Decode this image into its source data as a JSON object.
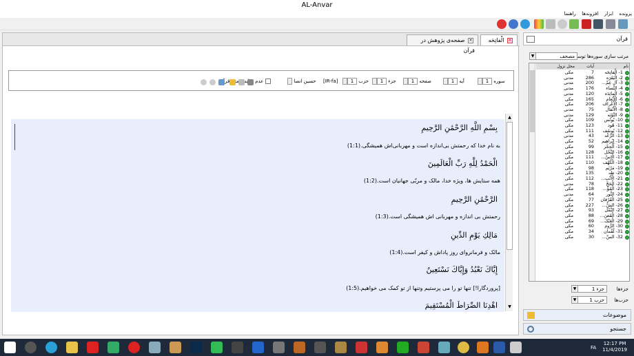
{
  "window": {
    "title": "AL-Anvar"
  },
  "menu": [
    "پرونده",
    "ابزار",
    "افزونه‌ها",
    "راهنما"
  ],
  "tabs": [
    {
      "label": "الْفاتِحَه"
    },
    {
      "label": "صفحه‌ی پژوهش در قرآن"
    }
  ],
  "controls": {
    "surah_label": "سوره",
    "surah_value": "1",
    "ayah_label": "آیه",
    "ayah_value": "1",
    "page_label": "صفحه",
    "page_value": "1",
    "juz_label": "جزء",
    "juz_value": "1",
    "hizb_label": "حزب",
    "hizb_value": "1",
    "lang_value": "[IR-fa]",
    "reciter_value": "حسین انصا",
    "hide_text_label": "عدم نمایش متن قرآن"
  },
  "reader": {
    "lines": [
      {
        "arabic": "بِسْمِ اللَّهِ الرَّحْمَٰنِ الرَّحِيمِ",
        "translation": "به نام خدا که رحمتش بی‌اندازه است و مهربانی‌اش همیشگی.(1:1)"
      },
      {
        "arabic": "الْحَمْدُ لِلَّهِ رَبِّ الْعَالَمِينَ",
        "translation": "همه ستایش ها، ویژه خدا، مالک و مربّی جهانیان است.(1:2)"
      },
      {
        "arabic": "الرَّحْمَٰنِ الرَّحِيمِ",
        "translation": "رحمتش بی اندازه و مهربانی اش همیشگی است.(1:3)"
      },
      {
        "arabic": "مَالِكِ يَوْمِ الدِّينِ",
        "translation": "مالک و فرمانروای روز پاداش و کیفر است.(1:4)"
      },
      {
        "arabic": "إِيَّاكَ نَعْبُدُ وَإِيَّاكَ نَسْتَعِينُ",
        "translation": "[پروردگارا!] تنها تو را می پرستیم وتنها از تو کمک می خواهیم.(1:5)"
      },
      {
        "arabic": "اهْدِنَا الصِّرَاطَ الْمُسْتَقِيمَ",
        "translation": ""
      }
    ]
  },
  "sidebar": {
    "header": "قرآن",
    "sort_label": "مرتب سازی سوره‌ها توسط",
    "sort_value": "مصحف",
    "columns": {
      "name": "نام",
      "ayat": "آیات",
      "order": "محل نزول"
    },
    "surahs": [
      {
        "name": "1- الْفاتِحَه",
        "ayat": "7",
        "place": "مکی"
      },
      {
        "name": "2- الْبَقَرَه",
        "ayat": "286",
        "place": "مدنی"
      },
      {
        "name": "3- آل عِمْ...",
        "ayat": "200",
        "place": "مدنی"
      },
      {
        "name": "4- النِّساء",
        "ayat": "176",
        "place": "مدنی"
      },
      {
        "name": "5- الْمائِدَه",
        "ayat": "120",
        "place": "مدنی"
      },
      {
        "name": "6- الْأَنْعام",
        "ayat": "165",
        "place": "مکی"
      },
      {
        "name": "7- الْأَعْراف",
        "ayat": "206",
        "place": "مکی"
      },
      {
        "name": "8- الْأَنْفال",
        "ayat": "75",
        "place": "مدنی"
      },
      {
        "name": "9- التَّوْبَه",
        "ayat": "129",
        "place": "مدنی"
      },
      {
        "name": "10- یُونُس",
        "ayat": "109",
        "place": "مکی"
      },
      {
        "name": "11- هُود",
        "ayat": "123",
        "place": "مکی"
      },
      {
        "name": "12- یُوسُف",
        "ayat": "111",
        "place": "مکی"
      },
      {
        "name": "13- الرَّعْد",
        "ayat": "43",
        "place": "مدنی"
      },
      {
        "name": "14- إِبْراهِیم",
        "ayat": "52",
        "place": "مکی"
      },
      {
        "name": "15- الْحِجْر",
        "ayat": "99",
        "place": "مکی"
      },
      {
        "name": "16- النَّحْل",
        "ayat": "128",
        "place": "مکی"
      },
      {
        "name": "17- الْإِسْ...",
        "ayat": "111",
        "place": "مکی"
      },
      {
        "name": "18- الْکَهْف",
        "ayat": "110",
        "place": "مکی"
      },
      {
        "name": "19- مَرْیَم",
        "ayat": "98",
        "place": "مکی"
      },
      {
        "name": "20- طه",
        "ayat": "135",
        "place": "مکی"
      },
      {
        "name": "21- الْأَنْبِ...",
        "ayat": "112",
        "place": "مکی"
      },
      {
        "name": "22- الْحَجّ",
        "ayat": "78",
        "place": "مدنی"
      },
      {
        "name": "23- الْمُؤْ...",
        "ayat": "118",
        "place": "مکی"
      },
      {
        "name": "24- النُّور",
        "ayat": "64",
        "place": "مدنی"
      },
      {
        "name": "25- الْفُرْقان",
        "ayat": "77",
        "place": "مکی"
      },
      {
        "name": "26- الشُّ...",
        "ayat": "227",
        "place": "مکی"
      },
      {
        "name": "27- النَّمْل",
        "ayat": "93",
        "place": "مکی"
      },
      {
        "name": "28- الْقَصَ...",
        "ayat": "88",
        "place": "مکی"
      },
      {
        "name": "29- الْعَنْکَ...",
        "ayat": "69",
        "place": "مکی"
      },
      {
        "name": "30- الرُّوم",
        "ayat": "60",
        "place": "مکی"
      },
      {
        "name": "31- لُقْمان",
        "ayat": "34",
        "place": "مکی"
      },
      {
        "name": "32- السَّ...",
        "ayat": "30",
        "place": "مکی"
      }
    ],
    "juz_label": "جزءها",
    "juz_value": "جزء 1",
    "hizb_label": "حزب‌ها",
    "hizb_value": "حزب 1",
    "topics_label": "موضوعات",
    "search_label": "جستجو"
  },
  "taskbar": {
    "time": "12:17 PM",
    "date": "11/4/2019",
    "lang": "FA"
  },
  "colors": {
    "reader_bg": "#e8eefc",
    "taskbar_bg": "#1e2a3a",
    "surah_dot": "#33aa33"
  }
}
